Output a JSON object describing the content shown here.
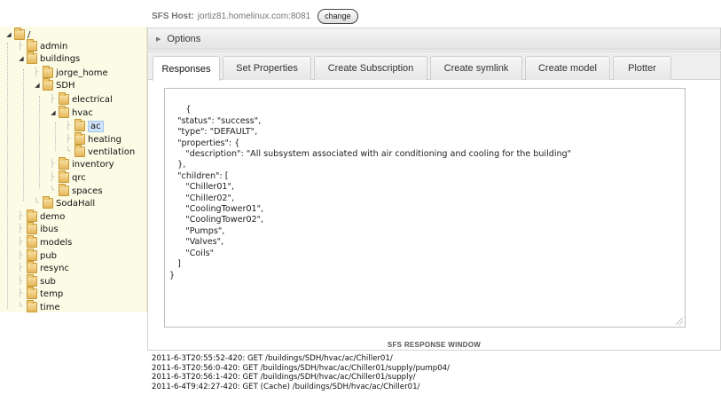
{
  "header": {
    "host_label": "SFS Host:",
    "host_value": "jortiz81.homelinux.com:8081",
    "change_label": "change"
  },
  "tree": {
    "root": "/",
    "nodes": [
      {
        "label": "admin",
        "expander": "leaf"
      },
      {
        "label": "buildings",
        "expander": "expanded"
      },
      {
        "label": "jorge_home",
        "expander": "leaf"
      },
      {
        "label": "SDH",
        "expander": "expanded"
      },
      {
        "label": "electrical",
        "expander": "leaf"
      },
      {
        "label": "hvac",
        "expander": "expanded"
      },
      {
        "label": "ac",
        "expander": "leaf",
        "selected": true
      },
      {
        "label": "heating",
        "expander": "leaf"
      },
      {
        "label": "ventilation",
        "expander": "leaf"
      },
      {
        "label": "inventory",
        "expander": "leaf"
      },
      {
        "label": "qrc",
        "expander": "leaf"
      },
      {
        "label": "spaces",
        "expander": "leaf"
      },
      {
        "label": "SodaHall",
        "expander": "leaf"
      },
      {
        "label": "demo",
        "expander": "leaf"
      },
      {
        "label": "ibus",
        "expander": "leaf"
      },
      {
        "label": "models",
        "expander": "leaf"
      },
      {
        "label": "pub",
        "expander": "leaf"
      },
      {
        "label": "resync",
        "expander": "leaf"
      },
      {
        "label": "sub",
        "expander": "leaf"
      },
      {
        "label": "temp",
        "expander": "leaf"
      },
      {
        "label": "time",
        "expander": "leaf"
      }
    ]
  },
  "options": {
    "label": "Options"
  },
  "tabs": [
    {
      "label": "Responses",
      "active": true
    },
    {
      "label": "Set Properties"
    },
    {
      "label": "Create Subscription"
    },
    {
      "label": "Create symlink"
    },
    {
      "label": "Create model"
    },
    {
      "label": "Plotter"
    }
  ],
  "response": {
    "text": "{\n   \"status\": \"success\",\n   \"type\": \"DEFAULT\",\n   \"properties\": {\n      \"description\": \"All subsystem associated with air conditioning and cooling for the building\"\n   },\n   \"children\": [\n      \"Chiller01\",\n      \"Chiller02\",\n      \"CoolingTower01\",\n      \"CoolingTower02\",\n      \"Pumps\",\n      \"Valves\",\n      \"Coils\"\n   ]\n}",
    "caption": "SFS RESPONSE WINDOW"
  },
  "log": [
    "2011-6-3T20:55:52-420: GET /buildings/SDH/hvac/ac/Chiller01/",
    "2011-6-3T20:56:0-420: GET /buildings/SDH/hvac/ac/Chiller01/supply/pump04/",
    "2011-6-3T20:56:1-420: GET /buildings/SDH/hvac/ac/Chiller01/supply/",
    "2011-6-4T9:42:27-420: GET (Cache) /buildings/SDH/hvac/ac/Chiller01/"
  ]
}
